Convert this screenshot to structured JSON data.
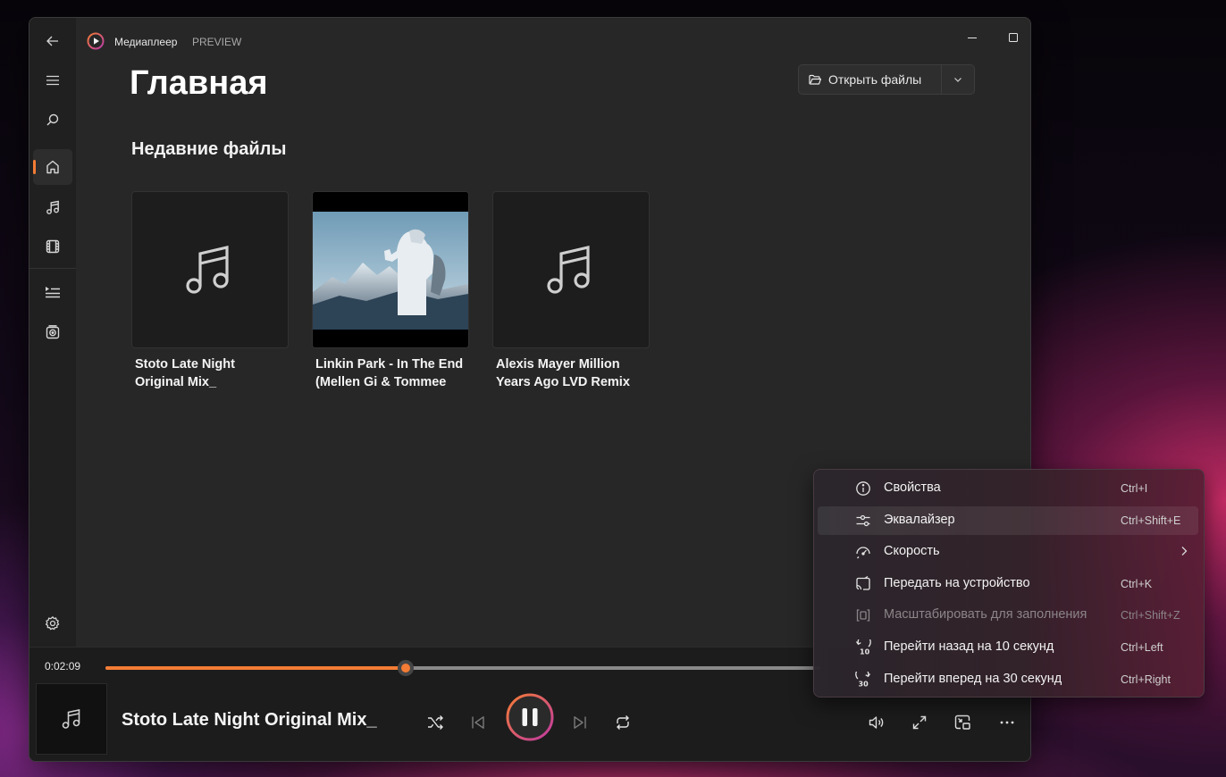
{
  "app": {
    "title": "Медиаплеер",
    "badge": "PREVIEW"
  },
  "header": {
    "title": "Главная",
    "open_files_label": "Открыть файлы"
  },
  "recent": {
    "title": "Недавние файлы",
    "items": [
      {
        "title": "Stoto Late Night Original Mix_",
        "art": "music-note-icon"
      },
      {
        "title": "Linkin Park - In The End (Mellen Gi & Tommee Profitt Remix)",
        "art": "mountain-photo"
      },
      {
        "title": "Alexis Mayer Million Years Ago LVD Remix",
        "art": "music-note-icon"
      }
    ]
  },
  "player": {
    "current_time": "0:02:09",
    "progress": 0.42,
    "now_playing_title": "Stoto Late Night Original Mix_"
  },
  "context_menu": {
    "items": [
      {
        "label": "Свойства",
        "shortcut": "Ctrl+I",
        "icon": "info-icon"
      },
      {
        "label": "Эквалайзер",
        "shortcut": "Ctrl+Shift+E",
        "icon": "equalizer-icon"
      },
      {
        "label": "Скорость",
        "shortcut": "",
        "icon": "speed-icon",
        "submenu": true
      },
      {
        "label": "Передать на устройство",
        "shortcut": "Ctrl+K",
        "icon": "cast-icon"
      },
      {
        "label": "Масштабировать для заполнения",
        "shortcut": "Ctrl+Shift+Z",
        "icon": "zoom-fill-icon",
        "disabled": true
      },
      {
        "label": "Перейти назад на 10 секунд",
        "shortcut": "Ctrl+Left",
        "icon": "skip-back-10-icon"
      },
      {
        "label": "Перейти вперед на 30 секунд",
        "shortcut": "Ctrl+Right",
        "icon": "skip-forward-30-icon"
      }
    ]
  },
  "colors": {
    "accent": "#f47c35",
    "window_bg": "#272727",
    "sidebar_bg": "#202020",
    "player_bg": "#1c1c1c"
  }
}
